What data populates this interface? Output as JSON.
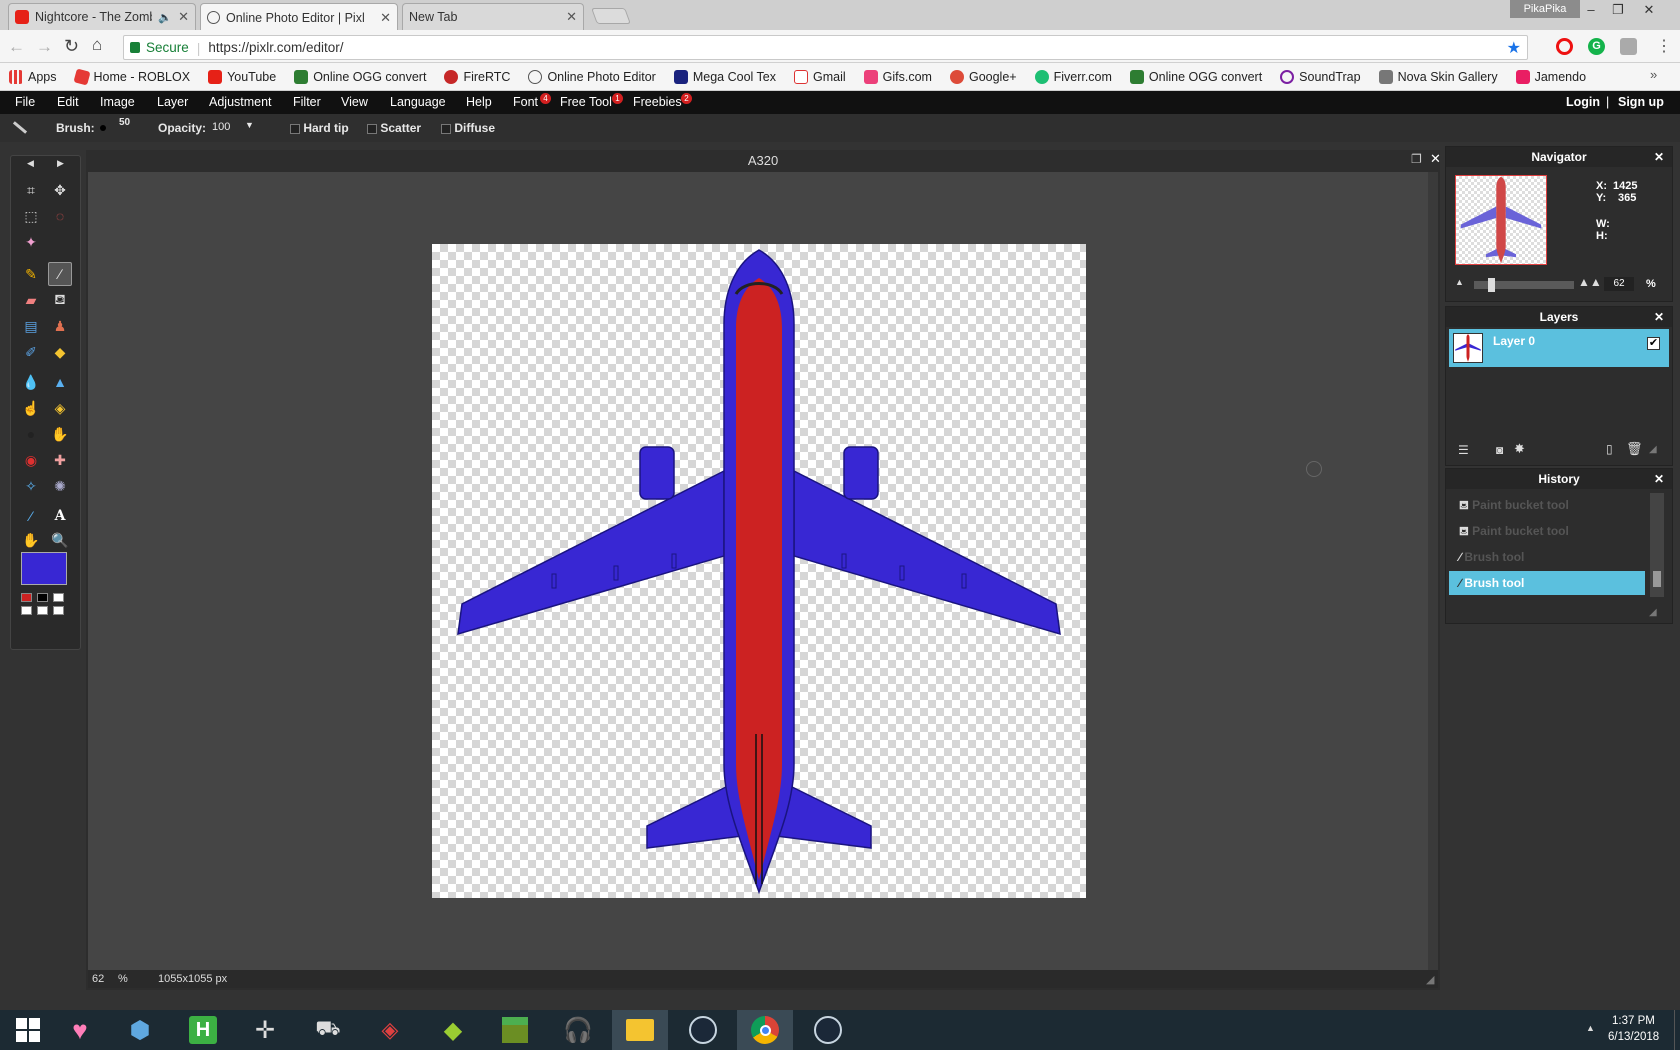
{
  "browser": {
    "tabs": [
      {
        "title": "Nightcore - The Zomb",
        "icon": "youtube-icon"
      },
      {
        "title": "Online Photo Editor | Pixl",
        "icon": "pixlr-icon"
      },
      {
        "title": "New Tab",
        "icon": ""
      }
    ],
    "profile": "PikaPika",
    "security": "Secure",
    "url": "https://pixlr.com/editor/",
    "bookmarks": [
      {
        "label": "Apps",
        "icon": "apps-grid-icon",
        "color": "#e53935"
      },
      {
        "label": "Home - ROBLOX",
        "icon": "roblox-icon",
        "color": "#e53935"
      },
      {
        "label": "YouTube",
        "icon": "youtube-icon",
        "color": "#e62117"
      },
      {
        "label": "Online OGG convert",
        "icon": "converter-icon",
        "color": "#2e7d32"
      },
      {
        "label": "FireRTC",
        "icon": "firertc-icon",
        "color": "#c62828"
      },
      {
        "label": "Online Photo Editor",
        "icon": "pixlr-icon",
        "color": "#555555"
      },
      {
        "label": "Mega Cool Tex",
        "icon": "megacool-icon",
        "color": "#1a237e"
      },
      {
        "label": "Gmail",
        "icon": "gmail-icon",
        "color": "#ffffff"
      },
      {
        "label": "Gifs.com",
        "icon": "gifs-icon",
        "color": "#ec407a"
      },
      {
        "label": "Google+",
        "icon": "google-plus-icon",
        "color": "#dd4b39"
      },
      {
        "label": "Fiverr.com",
        "icon": "fiverr-icon",
        "color": "#1dbf73"
      },
      {
        "label": "Online OGG convert",
        "icon": "converter-icon",
        "color": "#2e7d32"
      },
      {
        "label": "SoundTrap",
        "icon": "soundtrap-icon",
        "color": "#7b1fa2"
      },
      {
        "label": "Nova Skin Gallery",
        "icon": "nova-skin-icon",
        "color": "#777777"
      },
      {
        "label": "Jamendo",
        "icon": "jamendo-icon",
        "color": "#e91e63"
      }
    ]
  },
  "editor": {
    "menu": [
      "File",
      "Edit",
      "Image",
      "Layer",
      "Adjustment",
      "Filter",
      "View",
      "Language",
      "Help"
    ],
    "menu_extra": [
      {
        "label": "Font",
        "badge": "4"
      },
      {
        "label": "Free Tool",
        "badge": "1"
      },
      {
        "label": "Freebies",
        "badge": "2"
      }
    ],
    "login": "Login",
    "separator": "|",
    "signup": "Sign up",
    "options": {
      "brush_label": "Brush:",
      "brush_size": "50",
      "opacity_label": "Opacity:",
      "opacity_value": "100",
      "hard_tip": "Hard tip",
      "scatter": "Scatter",
      "diffuse": "Diffuse"
    },
    "document": {
      "title": "A320",
      "zoom": "62",
      "zoom_unit": "%",
      "size": "1055x1055 px"
    },
    "colors": {
      "primary": "#3827d3",
      "fuselage": "#cc2222",
      "swatches": [
        "#cc2222",
        "#000000",
        "#ffffff",
        "#ffffff",
        "#ffffff",
        "#ffffff"
      ]
    },
    "navigator": {
      "title": "Navigator",
      "x_label": "X:",
      "x": "1425",
      "y_label": "Y:",
      "y": "365",
      "w_label": "W:",
      "h_label": "H:",
      "zoom": "62",
      "zoom_unit": "%"
    },
    "layers": {
      "title": "Layers",
      "items": [
        {
          "name": "Layer 0",
          "visible": true
        }
      ]
    },
    "history": {
      "title": "History",
      "items": [
        {
          "label": "Paint bucket tool",
          "active": false
        },
        {
          "label": "Paint bucket tool",
          "active": false
        },
        {
          "label": "Brush tool",
          "active": false
        },
        {
          "label": "Brush tool",
          "active": true
        }
      ]
    }
  },
  "taskbar": {
    "time": "1:37 PM",
    "date": "6/13/2018"
  }
}
